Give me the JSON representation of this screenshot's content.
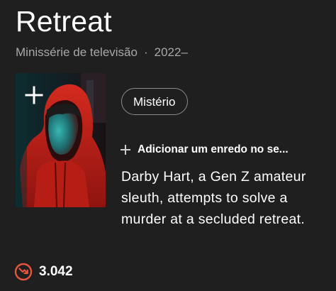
{
  "title": "Retreat",
  "meta": {
    "type": "Minissérie de televisão",
    "separator": "·",
    "years": "2022–"
  },
  "poster": {
    "add_icon": "plus-icon"
  },
  "genres": [
    "Mistério"
  ],
  "add_plot": {
    "icon": "plus-icon",
    "label": "Adicionar um enredo no se..."
  },
  "plot": "Darby Hart, a Gen Z amateur sleuth, attempts to solve a murder at a secluded retreat.",
  "popularity": {
    "icon": "trending-down-icon",
    "score": "3.042",
    "color": "#e8553f"
  },
  "colors": {
    "background": "#1f1f1f",
    "muted_text": "#a8a8a8",
    "chip_border": "#8a8a8a"
  }
}
